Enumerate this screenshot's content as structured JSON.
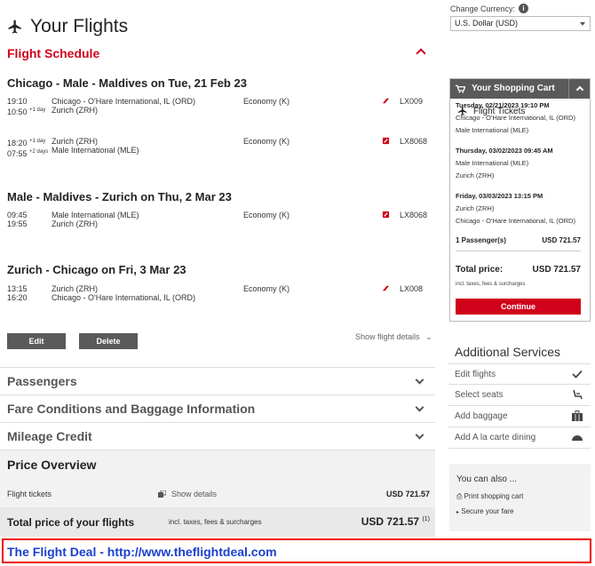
{
  "header": {
    "title": "Your Flights"
  },
  "schedule": {
    "title": "Flight Schedule",
    "legs": [
      {
        "title": "Chicago - Male - Maldives on Tue, 21 Feb 23",
        "segments": [
          {
            "dep_time": "19:10",
            "arr_time": "10:50",
            "arr_offset": "+1 day",
            "from": "Chicago - O'Hare International, IL (ORD)",
            "to": "Zurich (ZRH)",
            "cabin": "Economy (K)",
            "flight": "LX009"
          },
          {
            "dep_time": "18:20",
            "dep_offset": "+1 day",
            "arr_time": "07:55",
            "arr_offset": "+2 days",
            "from": "Zurich (ZRH)",
            "to": "Male International (MLE)",
            "cabin": "Economy (K)",
            "flight": "LX8068"
          }
        ]
      },
      {
        "title": "Male - Maldives - Zurich on Thu, 2 Mar 23",
        "segments": [
          {
            "dep_time": "09:45",
            "arr_time": "19:55",
            "from": "Male International (MLE)",
            "to": "Zurich (ZRH)",
            "cabin": "Economy (K)",
            "flight": "LX8068"
          }
        ]
      },
      {
        "title": "Zurich - Chicago on Fri, 3 Mar 23",
        "segments": [
          {
            "dep_time": "13:15",
            "arr_time": "16:20",
            "from": "Zurich (ZRH)",
            "to": "Chicago - O'Hare International, IL (ORD)",
            "cabin": "Economy (K)",
            "flight": "LX008"
          }
        ]
      }
    ],
    "edit_label": "Edit",
    "delete_label": "Delete",
    "show_details_label": "Show flight details"
  },
  "accordions": {
    "passengers": "Passengers",
    "fare": "Fare Conditions and Baggage Information",
    "mileage": "Mileage Credit"
  },
  "price": {
    "title": "Price Overview",
    "tickets_label": "Flight tickets",
    "show_details": "Show details",
    "tickets_amount": "USD 721.57",
    "total_label": "Total price of your flights",
    "total_note": "incl. taxes, fees & surcharges",
    "total_amount": "USD 721.57",
    "footnote": "(1)"
  },
  "currency": {
    "label": "Change Currency:",
    "selected": "U.S. Dollar (USD)"
  },
  "cart": {
    "title": "Your Shopping Cart",
    "subtitle": "Flight Tickets",
    "items": [
      {
        "date": "Tuesday, 02/21/2023 19:10 PM",
        "from": "Chicago - O'Hare International, IL (ORD)",
        "to": "Male International (MLE)"
      },
      {
        "date": "Thursday, 03/02/2023 09:45 AM",
        "from": "Male International (MLE)",
        "to": "Zurich (ZRH)"
      },
      {
        "date": "Friday, 03/03/2023 13:15 PM",
        "from": "Zurich (ZRH)",
        "to": "Chicago - O'Hare International, IL (ORD)"
      }
    ],
    "passengers_label": "1 Passenger(s)",
    "passengers_amount": "USD 721.57",
    "total_label": "Total price:",
    "total_amount": "USD 721.57",
    "total_note": "incl. taxes, fees & surcharges",
    "continue_label": "Continue"
  },
  "services": {
    "title": "Additional Services",
    "items": [
      {
        "label": "Edit flights",
        "icon": "check-icon"
      },
      {
        "label": "Select seats",
        "icon": "seat-icon"
      },
      {
        "label": "Add baggage",
        "icon": "baggage-icon"
      },
      {
        "label": "Add A la carte dining",
        "icon": "dining-icon"
      }
    ]
  },
  "also": {
    "title": "You can also ...",
    "print_label": "Print shopping cart",
    "secure_label": "Secure your fare"
  },
  "watermark": {
    "text": "The Flight Deal - http://www.theflightdeal.com"
  },
  "colors": {
    "accent": "#d0021b",
    "dark": "#5a5a5a",
    "link": "#1a3fcf"
  }
}
